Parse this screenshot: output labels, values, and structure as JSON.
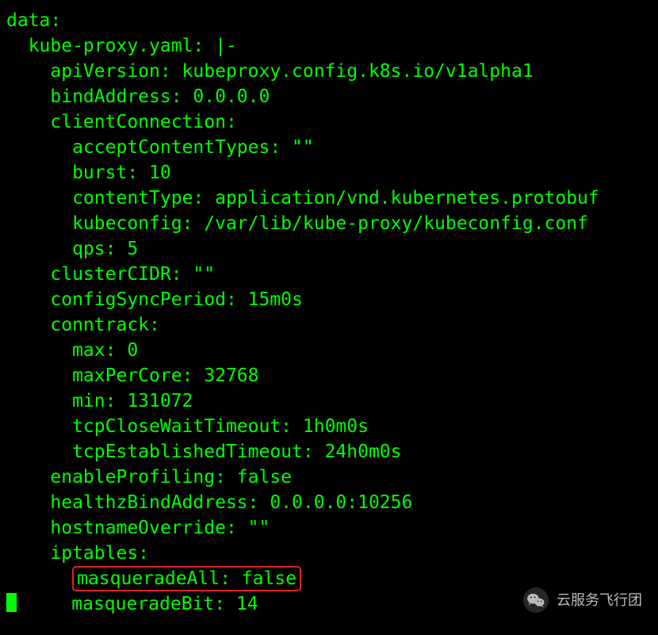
{
  "terminal": {
    "lines": [
      "data:",
      "  kube-proxy.yaml: |-",
      "    apiVersion: kubeproxy.config.k8s.io/v1alpha1",
      "    bindAddress: 0.0.0.0",
      "    clientConnection:",
      "      acceptContentTypes: \"\"",
      "      burst: 10",
      "      contentType: application/vnd.kubernetes.protobuf",
      "      kubeconfig: /var/lib/kube-proxy/kubeconfig.conf",
      "      qps: 5",
      "    clusterCIDR: \"\"",
      "    configSyncPeriod: 15m0s",
      "    conntrack:",
      "      max: 0",
      "      maxPerCore: 32768",
      "      min: 131072",
      "      tcpCloseWaitTimeout: 1h0m0s",
      "      tcpEstablishedTimeout: 24h0m0s",
      "    enableProfiling: false",
      "    healthzBindAddress: 0.0.0.0:10256",
      "    hostnameOverride: \"\"",
      "    iptables:"
    ],
    "highlighted_line_indent": "      ",
    "highlighted_line": "masqueradeAll: false",
    "last_line_indent": "      ",
    "last_line": "masqueradeBit: 14"
  },
  "watermark": {
    "text": "云服务飞行团"
  }
}
